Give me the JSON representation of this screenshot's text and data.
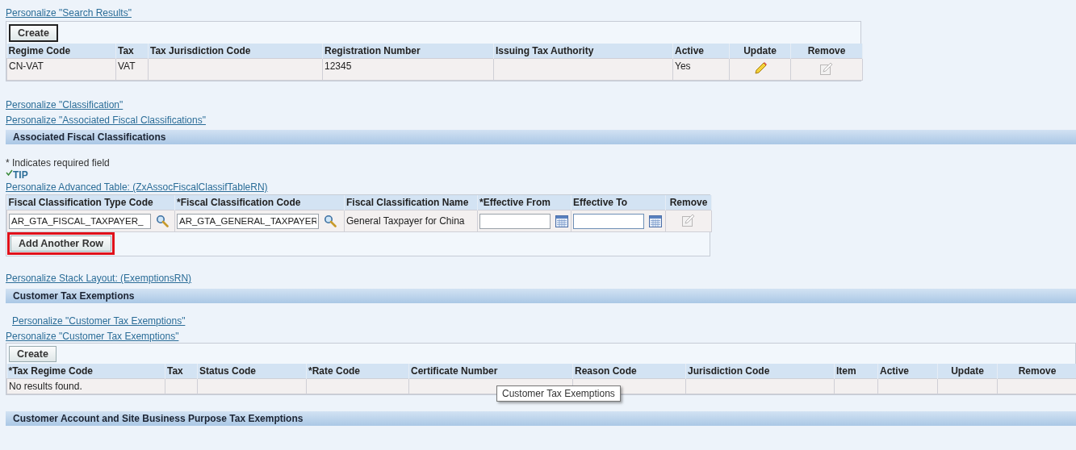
{
  "search_results": {
    "personalize_link": "Personalize \"Search Results\"",
    "create_button": {
      "label": "Create",
      "focused": true
    },
    "columns": [
      {
        "label": "Regime Code",
        "kind": "text"
      },
      {
        "label": "Tax",
        "kind": "text"
      },
      {
        "label": "Tax Jurisdiction Code",
        "kind": "text"
      },
      {
        "label": "Registration Number",
        "kind": "text"
      },
      {
        "label": "Issuing Tax Authority",
        "kind": "text"
      },
      {
        "label": "Active",
        "kind": "text"
      },
      {
        "label": "Update",
        "kind": "update"
      },
      {
        "label": "Remove",
        "kind": "remove"
      }
    ],
    "rows": [
      {
        "cells": [
          "CN-VAT",
          "VAT",
          null,
          "12345",
          null,
          "Yes"
        ],
        "update_disabled": false,
        "remove_disabled": true
      }
    ]
  },
  "links": [
    "Personalize \"Classification\"",
    "Personalize \"Associated Fiscal Classifications\""
  ],
  "fiscal_section": {
    "title": "Associated Fiscal Classifications",
    "required_note": "* Indicates required field",
    "tip": "TIP",
    "personalize_link": "Personalize Advanced Table: (ZxAssocFiscalClassifTableRN)",
    "columns": [
      "Fiscal Classification Type Code",
      "*Fiscal Classification Code",
      "Fiscal Classification Name",
      "*Effective From",
      "Effective To",
      "Remove"
    ],
    "row": {
      "type_code": {
        "value": "AR_GTA_FISCAL_TAXPAYER_",
        "focused": false
      },
      "classification_code": {
        "value": "AR_GTA_GENERAL_TAXPAYER",
        "focused": false
      },
      "name": "General Taxpayer for China",
      "effective_from": {
        "focused": false
      },
      "effective_to": {
        "focused": true
      },
      "remove_disabled": true
    },
    "add_row_button": {
      "label": "Add Another Row",
      "highlighted": true
    },
    "stack_link": "Personalize Stack Layout: (ExemptionsRN)"
  },
  "exemptions_section": {
    "title": "Customer Tax Exemptions",
    "links": [
      "Personalize \"Customer Tax Exemptions\"",
      "Personalize \"Customer Tax Exemptions\""
    ],
    "create_button": {
      "label": "Create",
      "focused": false
    },
    "columns": [
      "*Tax Regime Code",
      "Tax",
      "Status Code",
      "*Rate Code",
      "Certificate Number",
      "Reason Code",
      "Jurisdiction Code",
      "Item",
      "Active",
      "Update",
      "Remove"
    ],
    "empty_message": "No results found.",
    "tooltip": "Customer Tax Exemptions"
  },
  "account_section": {
    "title": "Customer Account and Site Business Purpose Tax Exemptions"
  }
}
